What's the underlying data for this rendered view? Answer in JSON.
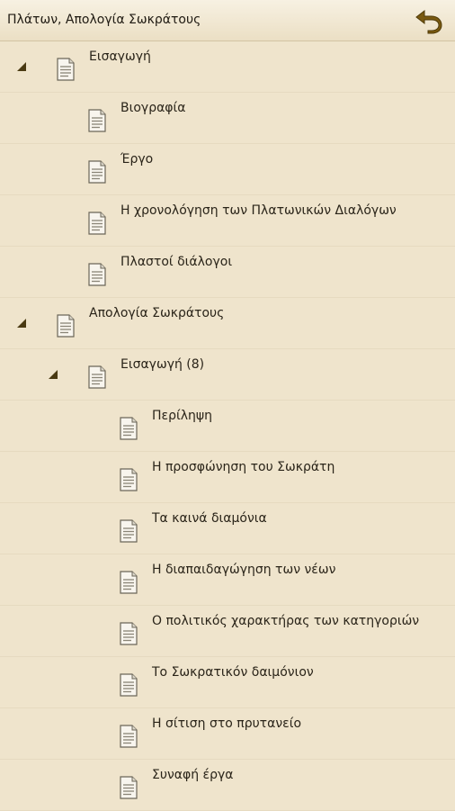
{
  "header": {
    "title": "Πλάτων, Απολογία Σωκράτους",
    "back_icon": "undo-arrow-icon",
    "accent": "#7a5a10"
  },
  "tree": {
    "doc_icon": "document-icon",
    "expand_icon": "triangle-expanded-icon",
    "items": [
      {
        "label": "Εισαγωγή",
        "level": 0,
        "expanded": true
      },
      {
        "label": "Βιογραφία",
        "level": 1,
        "expanded": false
      },
      {
        "label": "Έργο",
        "level": 1,
        "expanded": false
      },
      {
        "label": "Η χρονολόγηση των Πλατωνικών Διαλόγων",
        "level": 1,
        "expanded": false
      },
      {
        "label": "Πλαστοί διάλογοι",
        "level": 1,
        "expanded": false
      },
      {
        "label": "Απολογία Σωκράτους",
        "level": 0,
        "expanded": true
      },
      {
        "label": "Εισαγωγή (8)",
        "level": 1,
        "expanded": true
      },
      {
        "label": "Περίληψη",
        "level": 2,
        "expanded": false
      },
      {
        "label": "Η προσφώνηση του Σωκράτη",
        "level": 2,
        "expanded": false
      },
      {
        "label": "Τα καινά διαμόνια",
        "level": 2,
        "expanded": false
      },
      {
        "label": "Η διαπαιδαγώγηση των νέων",
        "level": 2,
        "expanded": false
      },
      {
        "label": "Ο πολιτικός χαρακτήρας των κατηγοριών",
        "level": 2,
        "expanded": false
      },
      {
        "label": "Το Σωκρατικόν δαιμόνιον",
        "level": 2,
        "expanded": false
      },
      {
        "label": "Η σίτιση στο πρυτανείο",
        "level": 2,
        "expanded": false
      },
      {
        "label": "Συναφή έργα",
        "level": 2,
        "expanded": false
      }
    ]
  }
}
